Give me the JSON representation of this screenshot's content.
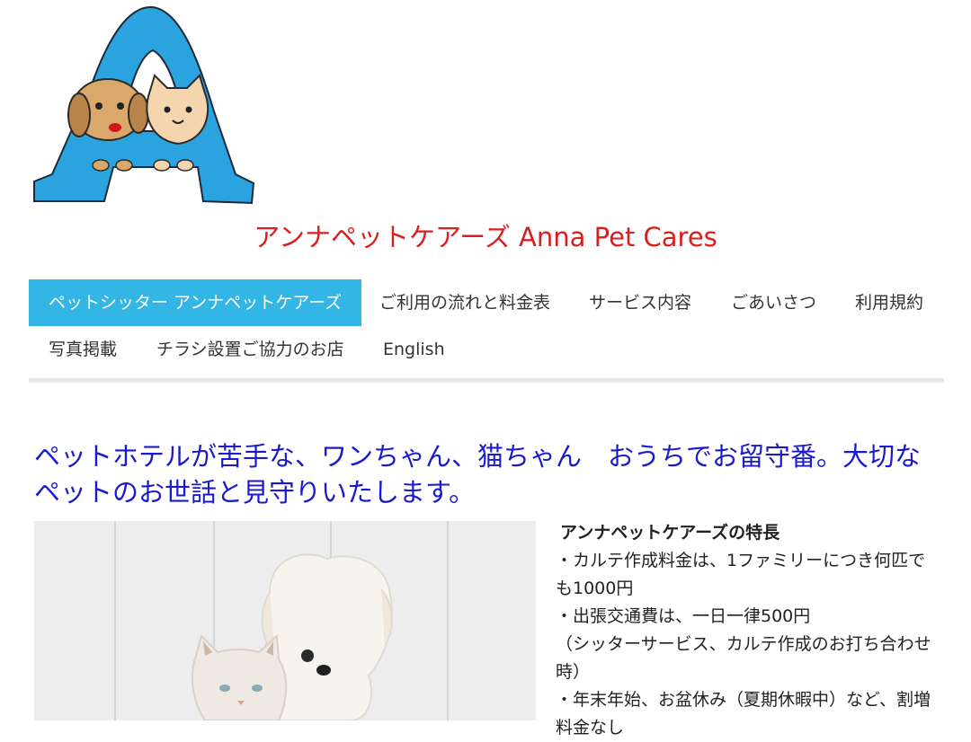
{
  "site": {
    "title": "アンナペットケアーズ Anna Pet Cares"
  },
  "nav": {
    "items": [
      {
        "label": "ペットシッター アンナペットケアーズ",
        "active": true
      },
      {
        "label": "ご利用の流れと料金表"
      },
      {
        "label": "サービス内容"
      },
      {
        "label": "ごあいさつ"
      },
      {
        "label": "利用規約"
      },
      {
        "label": "写真掲載"
      },
      {
        "label": "チラシ設置ご協力のお店"
      },
      {
        "label": "English"
      }
    ]
  },
  "main": {
    "headline": "ペットホテルが苦手な、ワンちゃん、猫ちゃん　おうちでお留守番。大切なペットのお世話と見守りいたします。",
    "features": {
      "title": "アンナペットケアーズの特長",
      "lines": [
        "・カルテ作成料金は、1ファミリーにつき何匹でも1000円",
        "・出張交通費は、一日一律500円",
        "（シッターサービス、カルテ作成のお打ち合わせ時）",
        "・年末年始、お盆休み（夏期休暇中）など、割増料金なし"
      ]
    }
  },
  "colors": {
    "title": "#d81e1e",
    "headline": "#1a1acc",
    "nav_active": "#33b5e5",
    "logo_blue": "#2aa3df"
  }
}
